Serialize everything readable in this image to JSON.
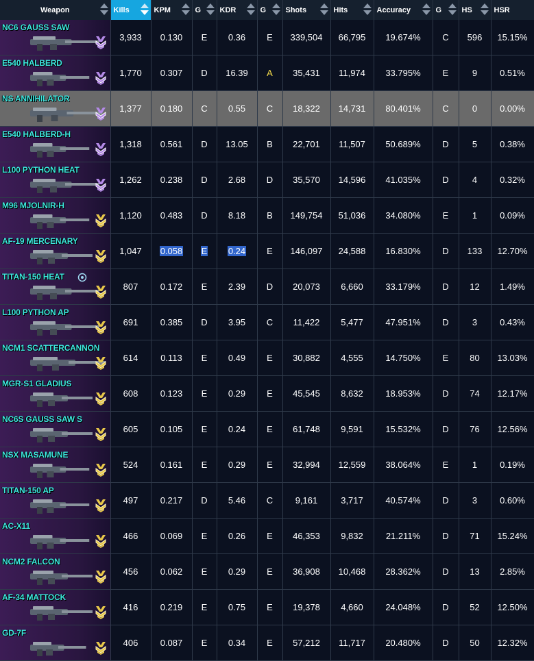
{
  "columns": [
    {
      "key": "weapon",
      "label": "Weapon",
      "sortable": true
    },
    {
      "key": "kills",
      "label": "Kills",
      "sortable": true,
      "sorted": "desc"
    },
    {
      "key": "kpm",
      "label": "KPM",
      "sortable": true
    },
    {
      "key": "g1",
      "label": "G",
      "sortable": true
    },
    {
      "key": "kdr",
      "label": "KDR",
      "sortable": true
    },
    {
      "key": "g2",
      "label": "G",
      "sortable": true
    },
    {
      "key": "shots",
      "label": "Shots",
      "sortable": true
    },
    {
      "key": "hits",
      "label": "Hits",
      "sortable": true
    },
    {
      "key": "accuracy",
      "label": "Accuracy",
      "sortable": true
    },
    {
      "key": "g3",
      "label": "G",
      "sortable": true
    },
    {
      "key": "hs",
      "label": "HS",
      "sortable": true
    },
    {
      "key": "hsr",
      "label": "HSR",
      "sortable": false
    }
  ],
  "rows": [
    {
      "weapon": "NC6 GAUSS SAW",
      "kills": "3,933",
      "kpm": "0.130",
      "g1": "E",
      "kdr": "0.36",
      "g2": "E",
      "shots": "339,504",
      "hits": "66,795",
      "accuracy": "19.674%",
      "g3": "C",
      "hs": "596",
      "hsr": "15.15%",
      "medal": "purple"
    },
    {
      "weapon": "E540 HALBERD",
      "kills": "1,770",
      "kpm": "0.307",
      "g1": "D",
      "kdr": "16.39",
      "g2": "A",
      "shots": "35,431",
      "hits": "11,974",
      "accuracy": "33.795%",
      "g3": "E",
      "hs": "9",
      "hsr": "0.51%",
      "medal": "purple"
    },
    {
      "weapon": "NS ANNIHILATOR",
      "kills": "1,377",
      "kpm": "0.180",
      "g1": "C",
      "kdr": "0.55",
      "g2": "C",
      "shots": "18,322",
      "hits": "14,731",
      "accuracy": "80.401%",
      "g3": "C",
      "hs": "0",
      "hsr": "0.00%",
      "medal": "purple",
      "highlight": true
    },
    {
      "weapon": "E540 HALBERD-H",
      "kills": "1,318",
      "kpm": "0.561",
      "g1": "D",
      "kdr": "13.05",
      "g2": "B",
      "shots": "22,701",
      "hits": "11,507",
      "accuracy": "50.689%",
      "g3": "D",
      "hs": "5",
      "hsr": "0.38%",
      "medal": "purple"
    },
    {
      "weapon": "L100 PYTHON HEAT",
      "kills": "1,262",
      "kpm": "0.238",
      "g1": "D",
      "kdr": "2.68",
      "g2": "D",
      "shots": "35,570",
      "hits": "14,596",
      "accuracy": "41.035%",
      "g3": "D",
      "hs": "4",
      "hsr": "0.32%",
      "medal": "purple"
    },
    {
      "weapon": "M96 MJOLNIR-H",
      "kills": "1,120",
      "kpm": "0.483",
      "g1": "D",
      "kdr": "8.18",
      "g2": "B",
      "shots": "149,754",
      "hits": "51,036",
      "accuracy": "34.080%",
      "g3": "E",
      "hs": "1",
      "hsr": "0.09%",
      "medal": "gold"
    },
    {
      "weapon": "AF-19 MERCENARY",
      "kills": "1,047",
      "kpm": "0.058",
      "g1": "E",
      "kdr": "0.24",
      "g2": "E",
      "shots": "146,097",
      "hits": "24,588",
      "accuracy": "16.830%",
      "g3": "D",
      "hs": "133",
      "hsr": "12.70%",
      "medal": "gold",
      "selected": true
    },
    {
      "weapon": "TITAN-150 HEAT",
      "kills": "807",
      "kpm": "0.172",
      "g1": "E",
      "kdr": "2.39",
      "g2": "D",
      "shots": "20,073",
      "hits": "6,660",
      "accuracy": "33.179%",
      "g3": "D",
      "hs": "12",
      "hsr": "1.49%",
      "medal": "gold",
      "mod": true
    },
    {
      "weapon": "L100 PYTHON AP",
      "kills": "691",
      "kpm": "0.385",
      "g1": "D",
      "kdr": "3.95",
      "g2": "C",
      "shots": "11,422",
      "hits": "5,477",
      "accuracy": "47.951%",
      "g3": "D",
      "hs": "3",
      "hsr": "0.43%",
      "medal": "gold"
    },
    {
      "weapon": "NCM1 SCATTERCANNON",
      "kills": "614",
      "kpm": "0.113",
      "g1": "E",
      "kdr": "0.49",
      "g2": "E",
      "shots": "30,882",
      "hits": "4,555",
      "accuracy": "14.750%",
      "g3": "E",
      "hs": "80",
      "hsr": "13.03%",
      "medal": "gold"
    },
    {
      "weapon": "MGR-S1 GLADIUS",
      "kills": "608",
      "kpm": "0.123",
      "g1": "E",
      "kdr": "0.29",
      "g2": "E",
      "shots": "45,545",
      "hits": "8,632",
      "accuracy": "18.953%",
      "g3": "D",
      "hs": "74",
      "hsr": "12.17%",
      "medal": "gold"
    },
    {
      "weapon": "NC6S GAUSS SAW S",
      "kills": "605",
      "kpm": "0.105",
      "g1": "E",
      "kdr": "0.24",
      "g2": "E",
      "shots": "61,748",
      "hits": "9,591",
      "accuracy": "15.532%",
      "g3": "D",
      "hs": "76",
      "hsr": "12.56%",
      "medal": "gold"
    },
    {
      "weapon": "NSX MASAMUNE",
      "kills": "524",
      "kpm": "0.161",
      "g1": "E",
      "kdr": "0.29",
      "g2": "E",
      "shots": "32,994",
      "hits": "12,559",
      "accuracy": "38.064%",
      "g3": "E",
      "hs": "1",
      "hsr": "0.19%",
      "medal": "gold"
    },
    {
      "weapon": "TITAN-150 AP",
      "kills": "497",
      "kpm": "0.217",
      "g1": "D",
      "kdr": "5.46",
      "g2": "C",
      "shots": "9,161",
      "hits": "3,717",
      "accuracy": "40.574%",
      "g3": "D",
      "hs": "3",
      "hsr": "0.60%",
      "medal": "gold"
    },
    {
      "weapon": "AC-X11",
      "kills": "466",
      "kpm": "0.069",
      "g1": "E",
      "kdr": "0.26",
      "g2": "E",
      "shots": "46,353",
      "hits": "9,832",
      "accuracy": "21.211%",
      "g3": "D",
      "hs": "71",
      "hsr": "15.24%",
      "medal": "gold"
    },
    {
      "weapon": "NCM2 FALCON",
      "kills": "456",
      "kpm": "0.062",
      "g1": "E",
      "kdr": "0.29",
      "g2": "E",
      "shots": "36,908",
      "hits": "10,468",
      "accuracy": "28.362%",
      "g3": "D",
      "hs": "13",
      "hsr": "2.85%",
      "medal": "gold"
    },
    {
      "weapon": "AF-34 MATTOCK",
      "kills": "416",
      "kpm": "0.219",
      "g1": "E",
      "kdr": "0.75",
      "g2": "E",
      "shots": "19,378",
      "hits": "4,660",
      "accuracy": "24.048%",
      "g3": "D",
      "hs": "52",
      "hsr": "12.50%",
      "medal": "gold"
    },
    {
      "weapon": "GD-7F",
      "kills": "406",
      "kpm": "0.087",
      "g1": "E",
      "kdr": "0.34",
      "g2": "E",
      "shots": "57,212",
      "hits": "11,717",
      "accuracy": "20.480%",
      "g3": "D",
      "hs": "50",
      "hsr": "12.32%",
      "medal": "gold"
    }
  ],
  "colors": {
    "header_bg": "#15202e",
    "sorted_header": "#16a6e0",
    "weapon_name": "#3ee8e0",
    "grade_a": "#f5dc4a",
    "highlight_row": "#6a6a6a",
    "selection": "#3266cc"
  }
}
